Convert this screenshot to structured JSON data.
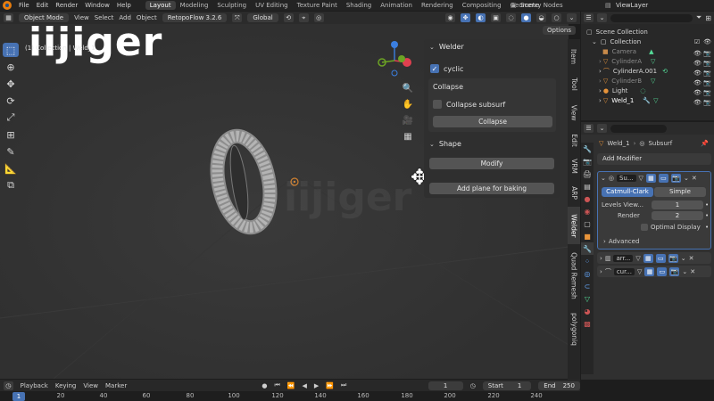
{
  "top_menu": [
    "File",
    "Edit",
    "Render",
    "Window",
    "Help"
  ],
  "workspaces": [
    {
      "label": "Layout",
      "active": true
    },
    {
      "label": "Modeling",
      "active": false
    },
    {
      "label": "Sculpting",
      "active": false
    },
    {
      "label": "UV Editing",
      "active": false
    },
    {
      "label": "Texture Paint",
      "active": false
    },
    {
      "label": "Shading",
      "active": false
    },
    {
      "label": "Animation",
      "active": false
    },
    {
      "label": "Rendering",
      "active": false
    },
    {
      "label": "Compositing",
      "active": false
    },
    {
      "label": "Geometry Nodes",
      "active": false
    }
  ],
  "scene": "Scene",
  "view_layer": "ViewLayer",
  "viewport_header": {
    "mode": "Object Mode",
    "menus": [
      "View",
      "Select",
      "Add",
      "Object"
    ],
    "addon": "RetopoFlow 3.2.6",
    "transform": "Global"
  },
  "viewport_info": "(1) Collection | Weld_1",
  "watermark": "iijiger",
  "options_label": "Options",
  "welder_panel": {
    "title": "Welder",
    "cyclic_label": "cyclic",
    "collapse_section": "Collapse",
    "collapse_subsurf_label": "Collapse subsurf",
    "collapse_button": "Collapse"
  },
  "shape_panel": {
    "title": "Shape",
    "modify_button": "Modify",
    "add_plane_button": "Add plane for baking"
  },
  "vertical_tabs": [
    "Item",
    "Tool",
    "View",
    "Edit",
    "VRM",
    "ARP",
    "Welder",
    "Quad Remesh",
    "polygoniq"
  ],
  "outliner": {
    "root": "Scene Collection",
    "collection": "Collection",
    "items": [
      {
        "name": "Camera",
        "dim": true
      },
      {
        "name": "CylinderA",
        "dim": true
      },
      {
        "name": "CylinderA.001",
        "dim": false
      },
      {
        "name": "CylinderB",
        "dim": true
      },
      {
        "name": "Light",
        "dim": false
      },
      {
        "name": "Weld_1",
        "dim": false
      }
    ]
  },
  "properties": {
    "object": "Weld_1",
    "modifier_breadcrumb": "Subsurf",
    "add_modifier": "Add Modifier",
    "modifier_name": "Su...",
    "catmull_clark": "Catmull-Clark",
    "simple": "Simple",
    "levels_viewport_label": "Levels View...",
    "levels_viewport_value": "1",
    "render_label": "Render",
    "render_value": "2",
    "optimal_display": "Optimal Display",
    "advanced": "Advanced",
    "other_modifiers": [
      "arr...",
      "cur..."
    ]
  },
  "timeline": {
    "menus": [
      "Playback",
      "Keying",
      "View",
      "Marker"
    ],
    "current_frame": "1",
    "start_label": "Start",
    "start_value": "1",
    "end_label": "End",
    "end_value": "250",
    "ruler": [
      "1",
      "20",
      "40",
      "60",
      "80",
      "100",
      "120",
      "140",
      "160",
      "180",
      "200",
      "220",
      "240"
    ]
  },
  "colors": {
    "accent": "#4772b3",
    "ring": "#a8a8a8",
    "axis_x": "#e04050",
    "axis_y": "#6ca324",
    "axis_z": "#3b7fe0"
  }
}
